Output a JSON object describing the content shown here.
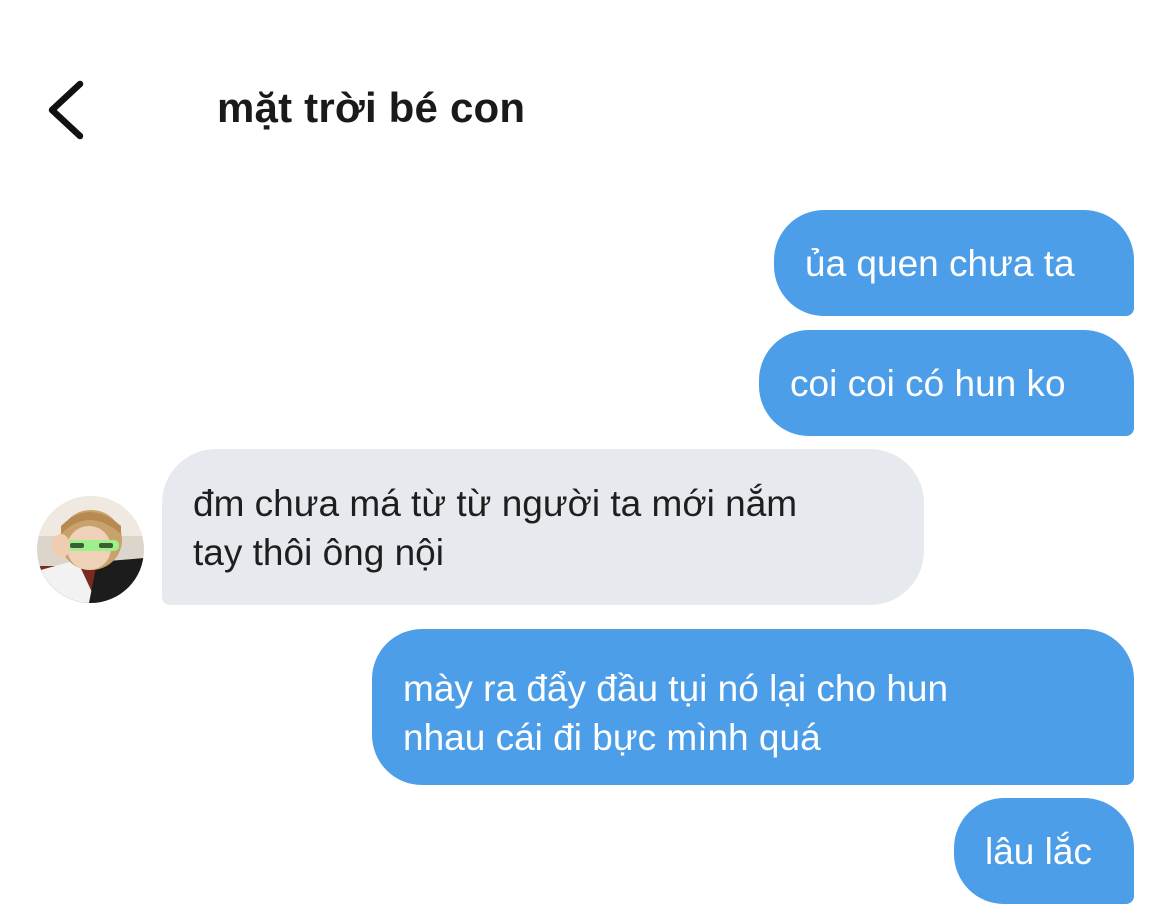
{
  "header": {
    "title": "mặt trời bé con",
    "back_icon": "chevron-left-icon"
  },
  "colors": {
    "sent_bubble": "#4d9ee9",
    "received_bubble": "#e6eaee",
    "sent_text": "#ffffff",
    "received_text": "#1e1e1e"
  },
  "messages": [
    {
      "direction": "sent",
      "lines": [
        "ủa quen chưa ta"
      ]
    },
    {
      "direction": "sent",
      "lines": [
        "coi coi có hun ko"
      ]
    },
    {
      "direction": "received",
      "lines": [
        "đm chưa má từ từ người ta mới nắm",
        "tay thôi ông nội"
      ]
    },
    {
      "direction": "sent",
      "lines": [
        "mày ra đẩy đầu tụi nó lại cho hun",
        "nhau cái đi bực mình quá"
      ]
    },
    {
      "direction": "sent",
      "lines": [
        "lâu lắc"
      ]
    }
  ]
}
